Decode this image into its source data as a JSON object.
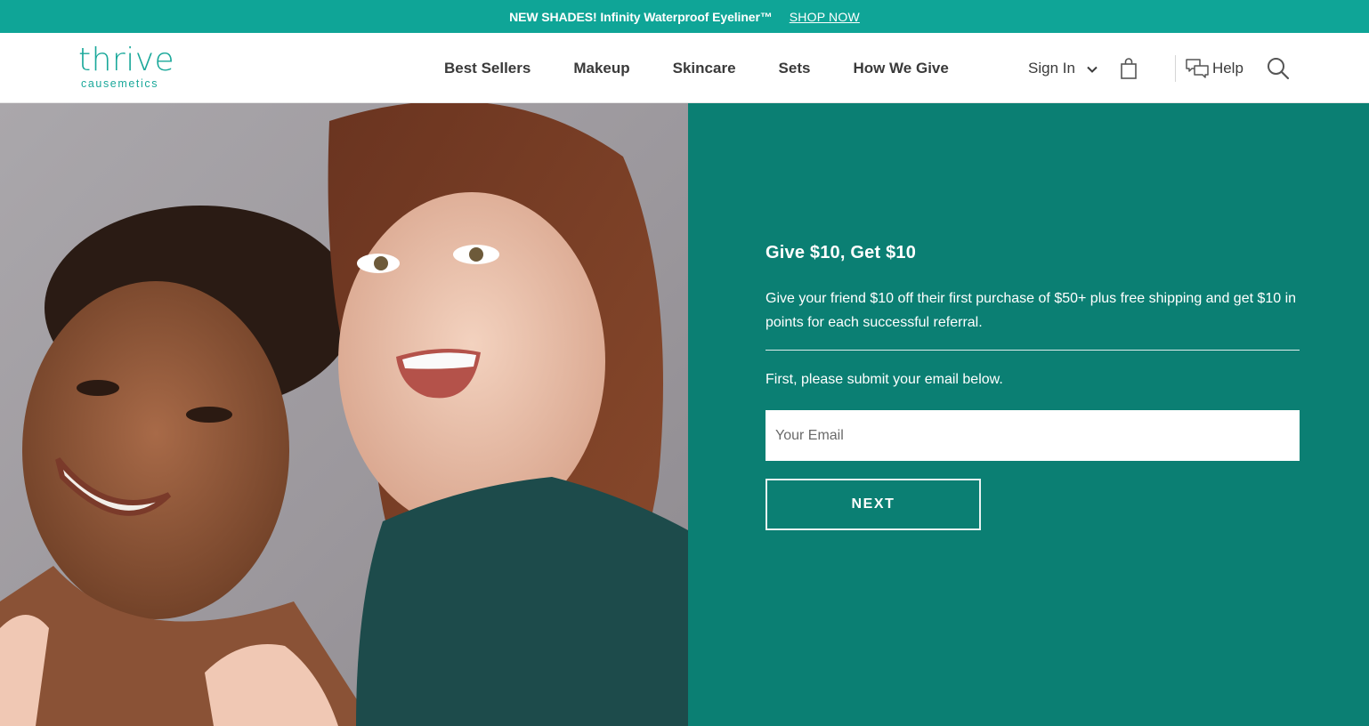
{
  "promo": {
    "text": "NEW SHADES! Infinity Waterproof Eyeliner™",
    "link": "SHOP NOW"
  },
  "header": {
    "logo_main": "thrive",
    "logo_sub": "causemetics",
    "nav": [
      "Best Sellers",
      "Makeup",
      "Skincare",
      "Sets",
      "How We Give"
    ],
    "sign_in": "Sign In",
    "help": "Help",
    "icons": [
      "chevron-down-icon",
      "shopping-bag-icon",
      "chat-bubbles-icon",
      "search-icon"
    ]
  },
  "referral": {
    "title": "Give $10, Get $10",
    "description": "Give your friend $10 off their first purchase of $50+ plus free shipping and get $10 in points for each successful referral.",
    "prompt": "First, please submit your email below.",
    "email_placeholder": "Your Email",
    "next_label": "NEXT"
  },
  "colors": {
    "promo_bg": "#0fa597",
    "panel_bg": "#0b7f73",
    "brand_teal": "#1aa89a",
    "nav_text": "#3a3a3a"
  }
}
